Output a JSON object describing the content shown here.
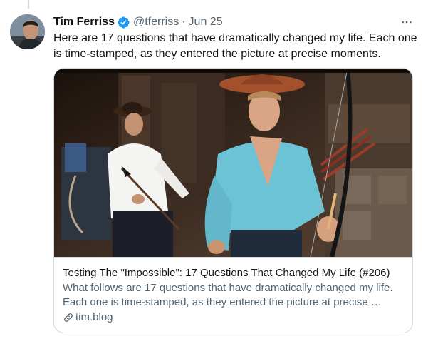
{
  "tweet": {
    "author": {
      "display_name": "Tim Ferriss",
      "handle": "@tferriss",
      "verified": true
    },
    "separator": "·",
    "date": "Jun 25",
    "text": "Here are 17 questions that have dramatically changed my life. Each one is time-stamped, as they entered the picture at precise moments.",
    "more_icon": "more-horizontal-icon"
  },
  "card": {
    "title": "Testing The \"Impossible\": 17 Questions That Changed My Life (#206)",
    "description": "What follows are 17 questions that have dramatically changed my life. Each one is time-stamped, as they entered the picture at precise …",
    "domain": "tim.blog",
    "domain_icon": "link-icon"
  },
  "colors": {
    "text_primary": "#0f1419",
    "text_secondary": "#536471",
    "verified_blue": "#1d9bf0",
    "border": "#cfd9de"
  }
}
